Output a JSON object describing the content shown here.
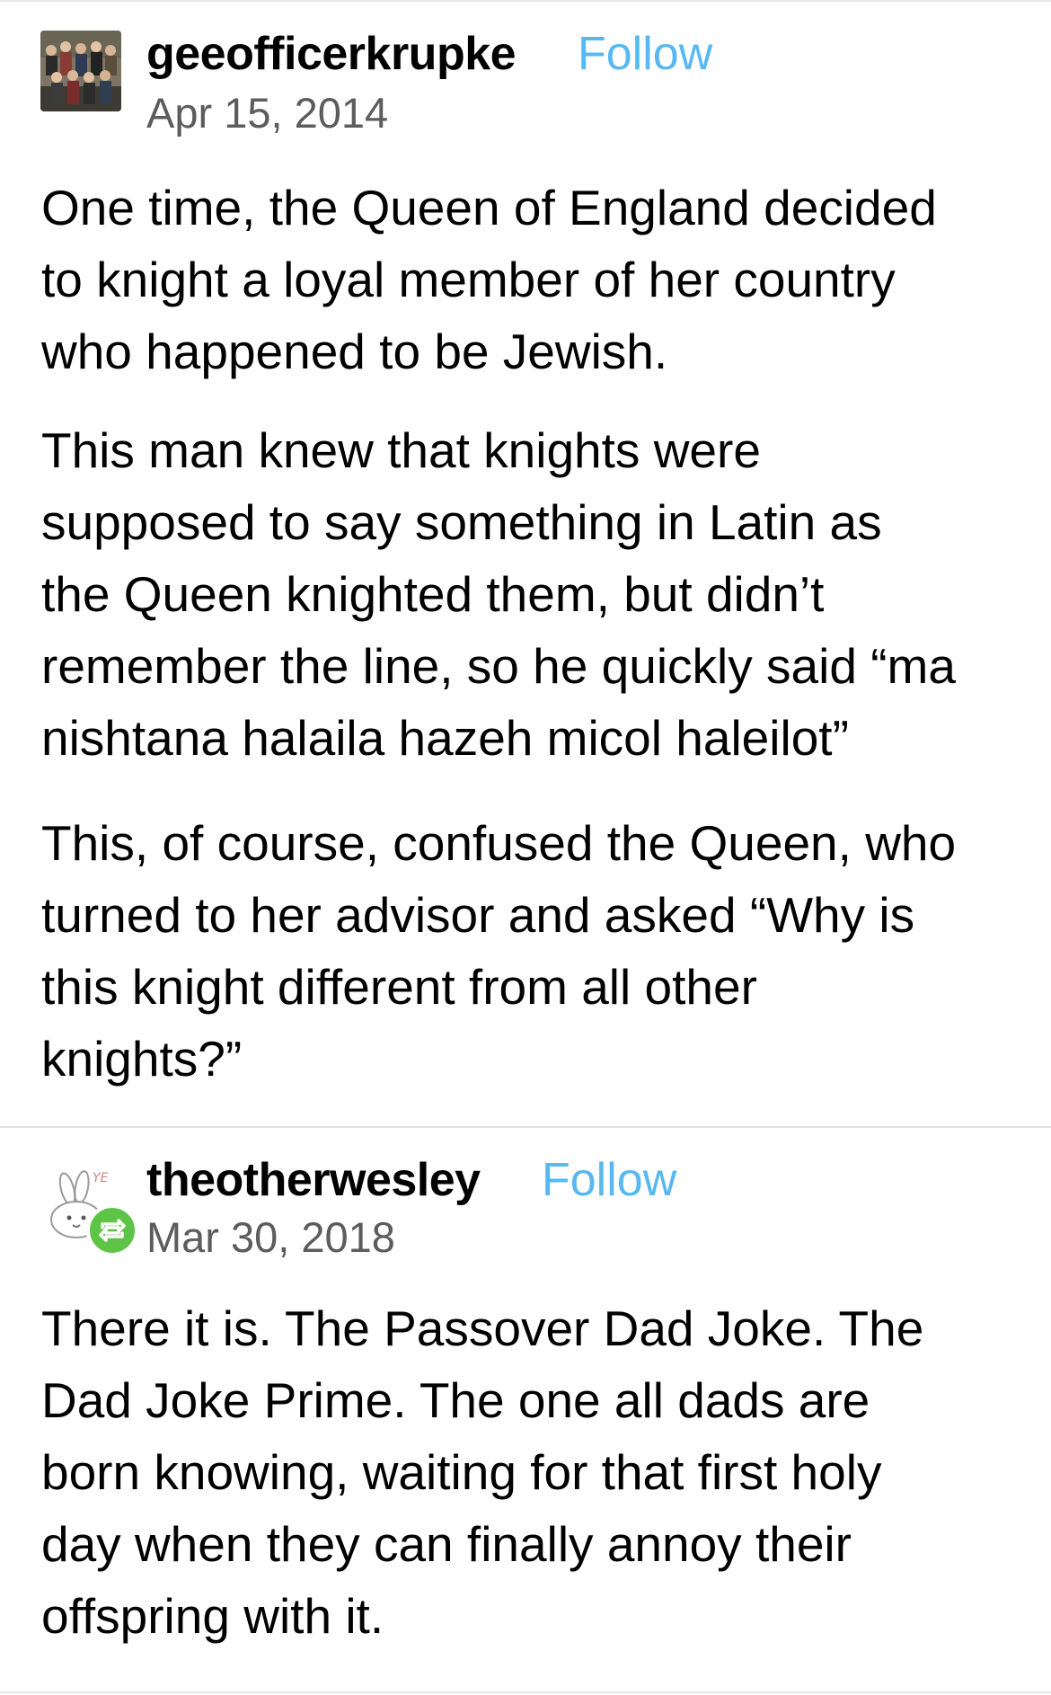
{
  "posts": [
    {
      "username": "geeofficerkrupke",
      "follow_label": "Follow",
      "date": "Apr 15, 2014",
      "paragraphs": [
        [
          "One time, the Queen of England decided",
          "to knight a loyal member of her country",
          "who happened to be Jewish."
        ],
        [
          "This man knew that knights were",
          "supposed to say something in Latin as",
          "the Queen knighted them, but didn’t",
          "remember the line, so he quickly said “ma",
          "nishtana halaila hazeh micol haleilot”"
        ],
        [
          "This, of course, confused the Queen, who",
          "turned to her advisor and asked “Why is",
          "this knight different from all other",
          "knights?”"
        ]
      ]
    },
    {
      "username": "theotherwesley",
      "follow_label": "Follow",
      "date": "Mar 30, 2018",
      "avatar_text": "YE",
      "paragraphs": [
        [
          "There it is. The Passover Dad Joke. The",
          "Dad Joke Prime. The one all dads are",
          "born knowing, waiting for that first holy",
          "day when they can finally annoy their",
          "offspring with it."
        ]
      ]
    }
  ],
  "colors": {
    "follow": "#58b8f0",
    "date": "#5c5c5c",
    "reblog_badge": "#5ec447",
    "divider": "#e2e2e2"
  },
  "icons": {
    "avatar_1": "group-photo-avatar",
    "avatar_2": "bunny-avatar",
    "reblog_badge": "reblog-icon"
  }
}
